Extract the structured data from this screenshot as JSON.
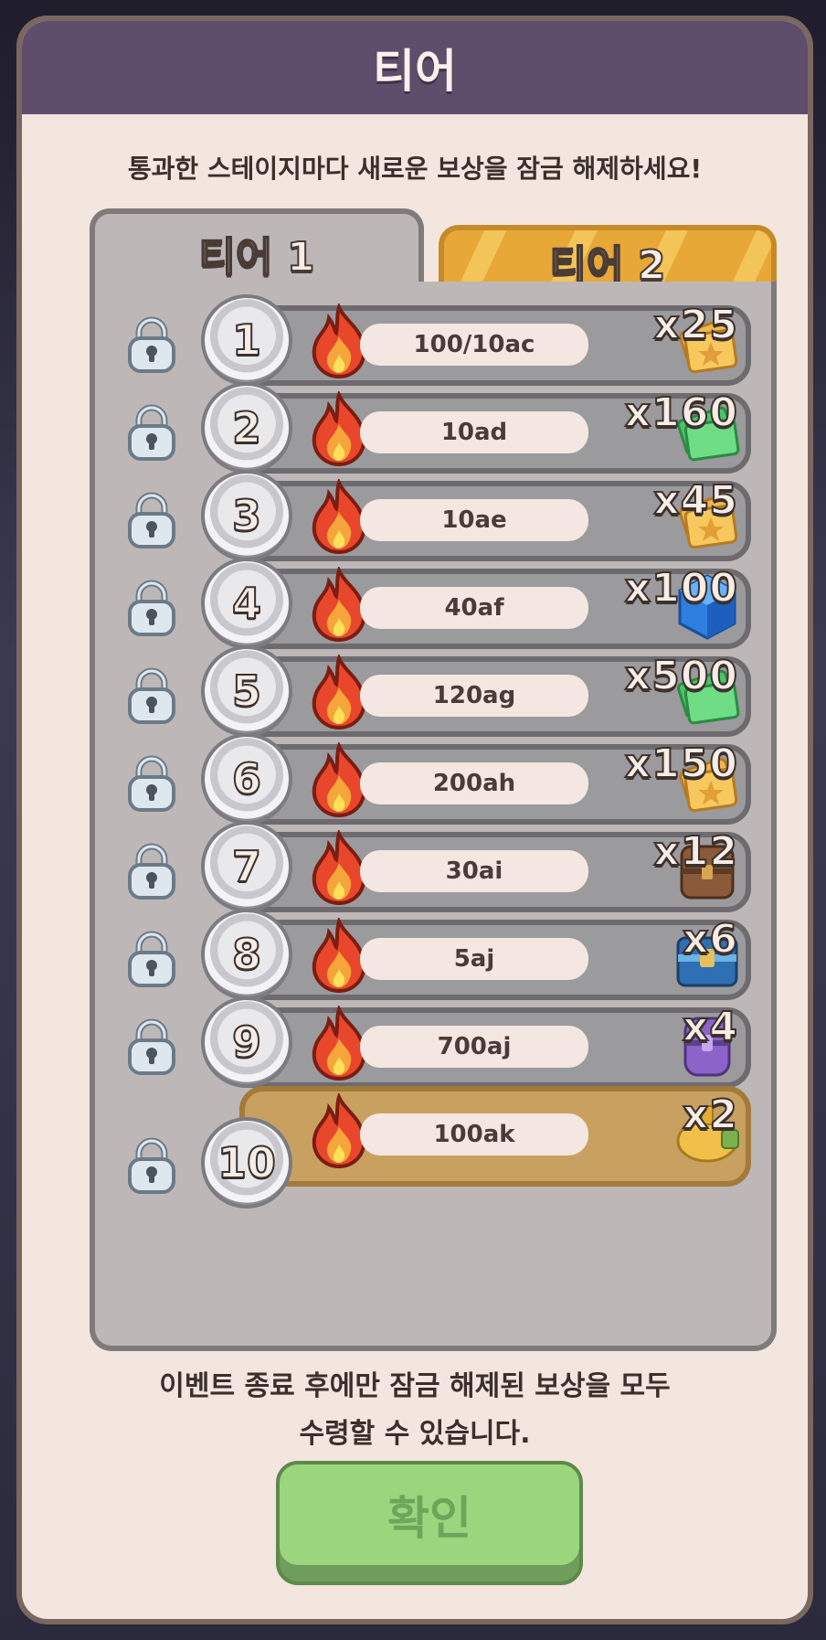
{
  "modal": {
    "title": "티어",
    "subtitle": "통과한 스테이지마다 새로운 보상을 잠금 해제하세요!",
    "footer_line1": "이벤트 종료 후에만 잠금 해제된 보상을 모두",
    "footer_line2": "수령할 수 있습니다.",
    "confirm_label": "확인"
  },
  "tabs": [
    {
      "label": "티어 1",
      "active": true
    },
    {
      "label": "티어 2",
      "active": false
    }
  ],
  "tiers": [
    {
      "level": "1",
      "requirement": "100/10ac",
      "quantity": "x25",
      "reward_icon": "gold-ticket-icon",
      "locked": true
    },
    {
      "level": "2",
      "requirement": "10ad",
      "quantity": "x160",
      "reward_icon": "green-ticket-icon",
      "locked": true
    },
    {
      "level": "3",
      "requirement": "10ae",
      "quantity": "x45",
      "reward_icon": "gold-ticket-icon",
      "locked": true
    },
    {
      "level": "4",
      "requirement": "40af",
      "quantity": "x100",
      "reward_icon": "blue-gem-icon",
      "locked": true
    },
    {
      "level": "5",
      "requirement": "120ag",
      "quantity": "x500",
      "reward_icon": "green-ticket-icon",
      "locked": true
    },
    {
      "level": "6",
      "requirement": "200ah",
      "quantity": "x150",
      "reward_icon": "gold-ticket-icon",
      "locked": true
    },
    {
      "level": "7",
      "requirement": "30ai",
      "quantity": "x12",
      "reward_icon": "brown-chest-icon",
      "locked": true
    },
    {
      "level": "8",
      "requirement": "5aj",
      "quantity": "x6",
      "reward_icon": "blue-chest-icon",
      "locked": true
    },
    {
      "level": "9",
      "requirement": "700aj",
      "quantity": "x4",
      "reward_icon": "purple-chest-icon",
      "locked": true
    },
    {
      "level": "10",
      "requirement": "100ak",
      "quantity": "x2",
      "reward_icon": "golden-cannon-icon",
      "locked": true
    }
  ],
  "colors": {
    "header": "#5f4d6c",
    "panel": "#bdb8b7",
    "tab_active": "#bdb8b7",
    "tab_inactive": "#e8a838",
    "confirm": "#9bd67f"
  }
}
